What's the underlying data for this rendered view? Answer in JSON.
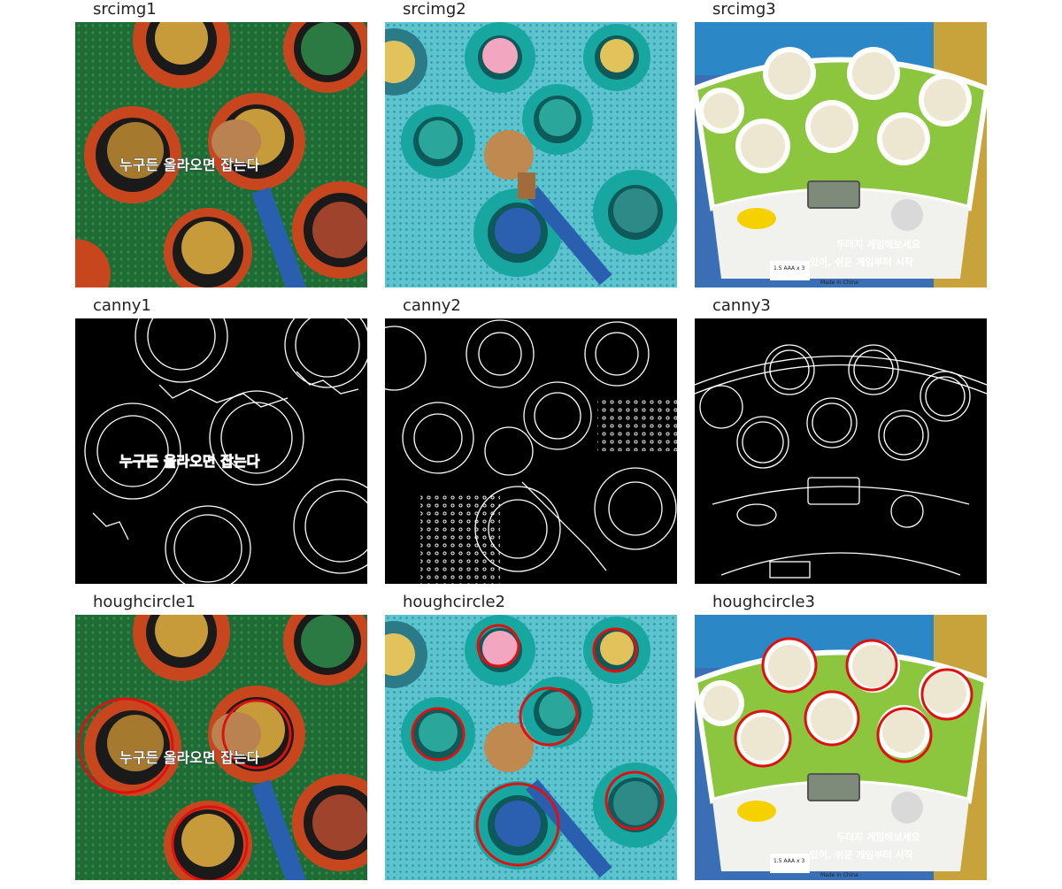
{
  "grid": {
    "row1": {
      "srcimg1": {
        "title": "srcimg1",
        "caption": "누구든 올라오면 잡는다"
      },
      "srcimg2": {
        "title": "srcimg2"
      },
      "srcimg3": {
        "title": "srcimg3",
        "toy_text_1": "두더지 게임해보세요",
        "toy_text_2": "있어, 쉬운 게임부터 시작",
        "battery_label": "1.5 AAA x 3",
        "made_in": "Made in China"
      }
    },
    "row2": {
      "canny1": {
        "title": "canny1",
        "caption": "누구든 올라오면 잡는다"
      },
      "canny2": {
        "title": "canny2"
      },
      "canny3": {
        "title": "canny3"
      }
    },
    "row3": {
      "houghcircle1": {
        "title": "houghcircle1",
        "caption": "누구든 올라오면 잡는다"
      },
      "houghcircle2": {
        "title": "houghcircle2"
      },
      "houghcircle3": {
        "title": "houghcircle3",
        "toy_text_1": "두더지 게임해보세요",
        "toy_text_2": "있어, 쉬운 게임부터 시작",
        "battery_label": "1.5 AAA x 3",
        "made_in": "Made in China"
      }
    }
  },
  "colors": {
    "detection_circle": "#e01010",
    "green_mat": "#1f6b35",
    "teal_mat": "#5bc4cf",
    "toy_green": "#8cc63f",
    "edge_background": "#000000",
    "edge_lines": "#ffffff"
  }
}
